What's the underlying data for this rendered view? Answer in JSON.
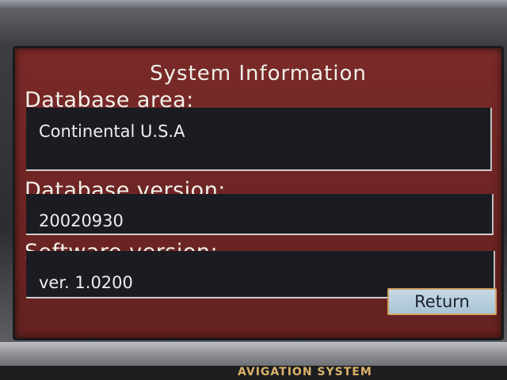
{
  "device": {
    "brand_strip_text": "AVIGATION SYSTEM"
  },
  "screen": {
    "title": "System Information",
    "fields": [
      {
        "label": "Database area:",
        "value": "Continental U.S.A"
      },
      {
        "label": "Database version:",
        "value": "20020930"
      },
      {
        "label": "Software version:",
        "value": "ver. 1.0200"
      }
    ],
    "return_label": "Return"
  },
  "colors": {
    "screen_background": "#6e2524",
    "field_background": "#1b1c21",
    "button_background": "#b4cbdb",
    "button_border": "#d3a463",
    "brand_text": "#d9b46a"
  }
}
